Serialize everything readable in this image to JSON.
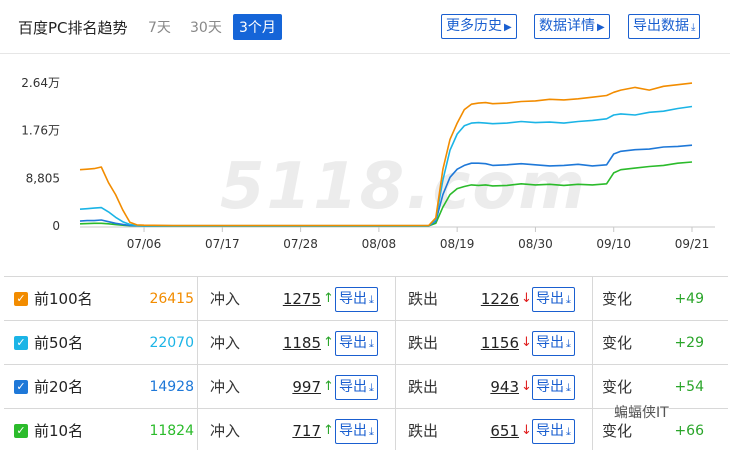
{
  "header": {
    "title": "百度PC排名趋势",
    "ranges": [
      "7天",
      "30天",
      "3个月"
    ],
    "active_range": "3个月",
    "buttons": {
      "history": "更多历史",
      "details": "数据详情",
      "export": "导出数据"
    }
  },
  "watermark": "5118.com",
  "colors": {
    "top100": "#f28c00",
    "top50": "#1bb4e6",
    "top20": "#1e78d8",
    "top10": "#2bbb2b",
    "accent": "#1565d8",
    "up": "#2aa52a",
    "down": "#e02020"
  },
  "chart_data": {
    "type": "line",
    "y_tick_labels": [
      "0",
      "8,805",
      "1.76万",
      "2.64万"
    ],
    "ylim": [
      0,
      26415
    ],
    "x_tick_labels": [
      "07/06",
      "07/17",
      "07/28",
      "08/08",
      "08/19",
      "08/30",
      "09/10",
      "09/21"
    ],
    "grid": false,
    "x": [
      "06/27",
      "06/28",
      "06/29",
      "06/30",
      "07/01",
      "07/02",
      "07/03",
      "07/04",
      "07/05",
      "07/06",
      "07/10",
      "07/17",
      "07/24",
      "07/28",
      "08/01",
      "08/08",
      "08/12",
      "08/15",
      "08/16",
      "08/17",
      "08/18",
      "08/19",
      "08/20",
      "08/21",
      "08/22",
      "08/23",
      "08/24",
      "08/26",
      "08/28",
      "08/30",
      "09/01",
      "09/03",
      "09/05",
      "09/07",
      "09/09",
      "09/10",
      "09/11",
      "09/13",
      "09/15",
      "09/17",
      "09/19",
      "09/21"
    ],
    "series": [
      {
        "name": "前100名",
        "values": [
          10400,
          10500,
          10600,
          10900,
          8000,
          5800,
          3000,
          700,
          200,
          150,
          100,
          100,
          100,
          100,
          100,
          100,
          100,
          100,
          1500,
          10500,
          16000,
          19000,
          21500,
          22500,
          22700,
          22800,
          22600,
          22700,
          23000,
          23100,
          23400,
          23300,
          23500,
          23800,
          24100,
          24700,
          25100,
          25600,
          25100,
          25800,
          26100,
          26400
        ]
      },
      {
        "name": "前50名",
        "values": [
          3100,
          3200,
          3300,
          3400,
          2600,
          1600,
          800,
          300,
          100,
          80,
          60,
          60,
          60,
          60,
          60,
          60,
          60,
          60,
          1200,
          8500,
          14000,
          17000,
          18500,
          19000,
          19100,
          19000,
          18900,
          19000,
          19300,
          19100,
          19200,
          19000,
          19300,
          19500,
          19800,
          20500,
          20700,
          20500,
          21000,
          21200,
          21700,
          22070
        ]
      },
      {
        "name": "前20名",
        "values": [
          900,
          1000,
          1000,
          1100,
          800,
          500,
          300,
          100,
          50,
          40,
          30,
          30,
          30,
          30,
          30,
          30,
          30,
          30,
          900,
          5800,
          9000,
          10500,
          11200,
          11600,
          11600,
          11500,
          11200,
          11300,
          11500,
          11300,
          11100,
          11200,
          11400,
          11100,
          11300,
          13300,
          13800,
          14100,
          14200,
          14600,
          14700,
          14928
        ]
      },
      {
        "name": "前10名",
        "values": [
          400,
          450,
          500,
          500,
          400,
          250,
          150,
          50,
          30,
          20,
          20,
          20,
          20,
          20,
          20,
          20,
          20,
          20,
          500,
          3500,
          5800,
          6900,
          7300,
          7600,
          7500,
          7600,
          7400,
          7500,
          7800,
          7600,
          7700,
          7500,
          7700,
          7600,
          7800,
          9800,
          10400,
          10700,
          11000,
          11200,
          11600,
          11824
        ]
      }
    ]
  },
  "table": {
    "rows": [
      {
        "key": "top100",
        "label": "前100名",
        "total": "26415",
        "in_label": "冲入",
        "in_value": "1275",
        "in_arrow": "↑",
        "out_label": "跌出",
        "out_value": "1226",
        "out_arrow": "↓",
        "export_label": "导出",
        "change_label": "变化",
        "change_value": "+49"
      },
      {
        "key": "top50",
        "label": "前50名",
        "total": "22070",
        "in_label": "冲入",
        "in_value": "1185",
        "in_arrow": "↑",
        "out_label": "跌出",
        "out_value": "1156",
        "out_arrow": "↓",
        "export_label": "导出",
        "change_label": "变化",
        "change_value": "+29"
      },
      {
        "key": "top20",
        "label": "前20名",
        "total": "14928",
        "in_label": "冲入",
        "in_value": "997",
        "in_arrow": "↑",
        "out_label": "跌出",
        "out_value": "943",
        "out_arrow": "↓",
        "export_label": "导出",
        "change_label": "变化",
        "change_value": "+54"
      },
      {
        "key": "top10",
        "label": "前10名",
        "total": "11824",
        "in_label": "冲入",
        "in_value": "717",
        "in_arrow": "↑",
        "out_label": "跌出",
        "out_value": "651",
        "out_arrow": "↓",
        "export_label": "导出",
        "change_label": "变化",
        "change_value": "+66"
      }
    ]
  },
  "overlay": {
    "wechat_label": "蝙蝠侠IT"
  }
}
